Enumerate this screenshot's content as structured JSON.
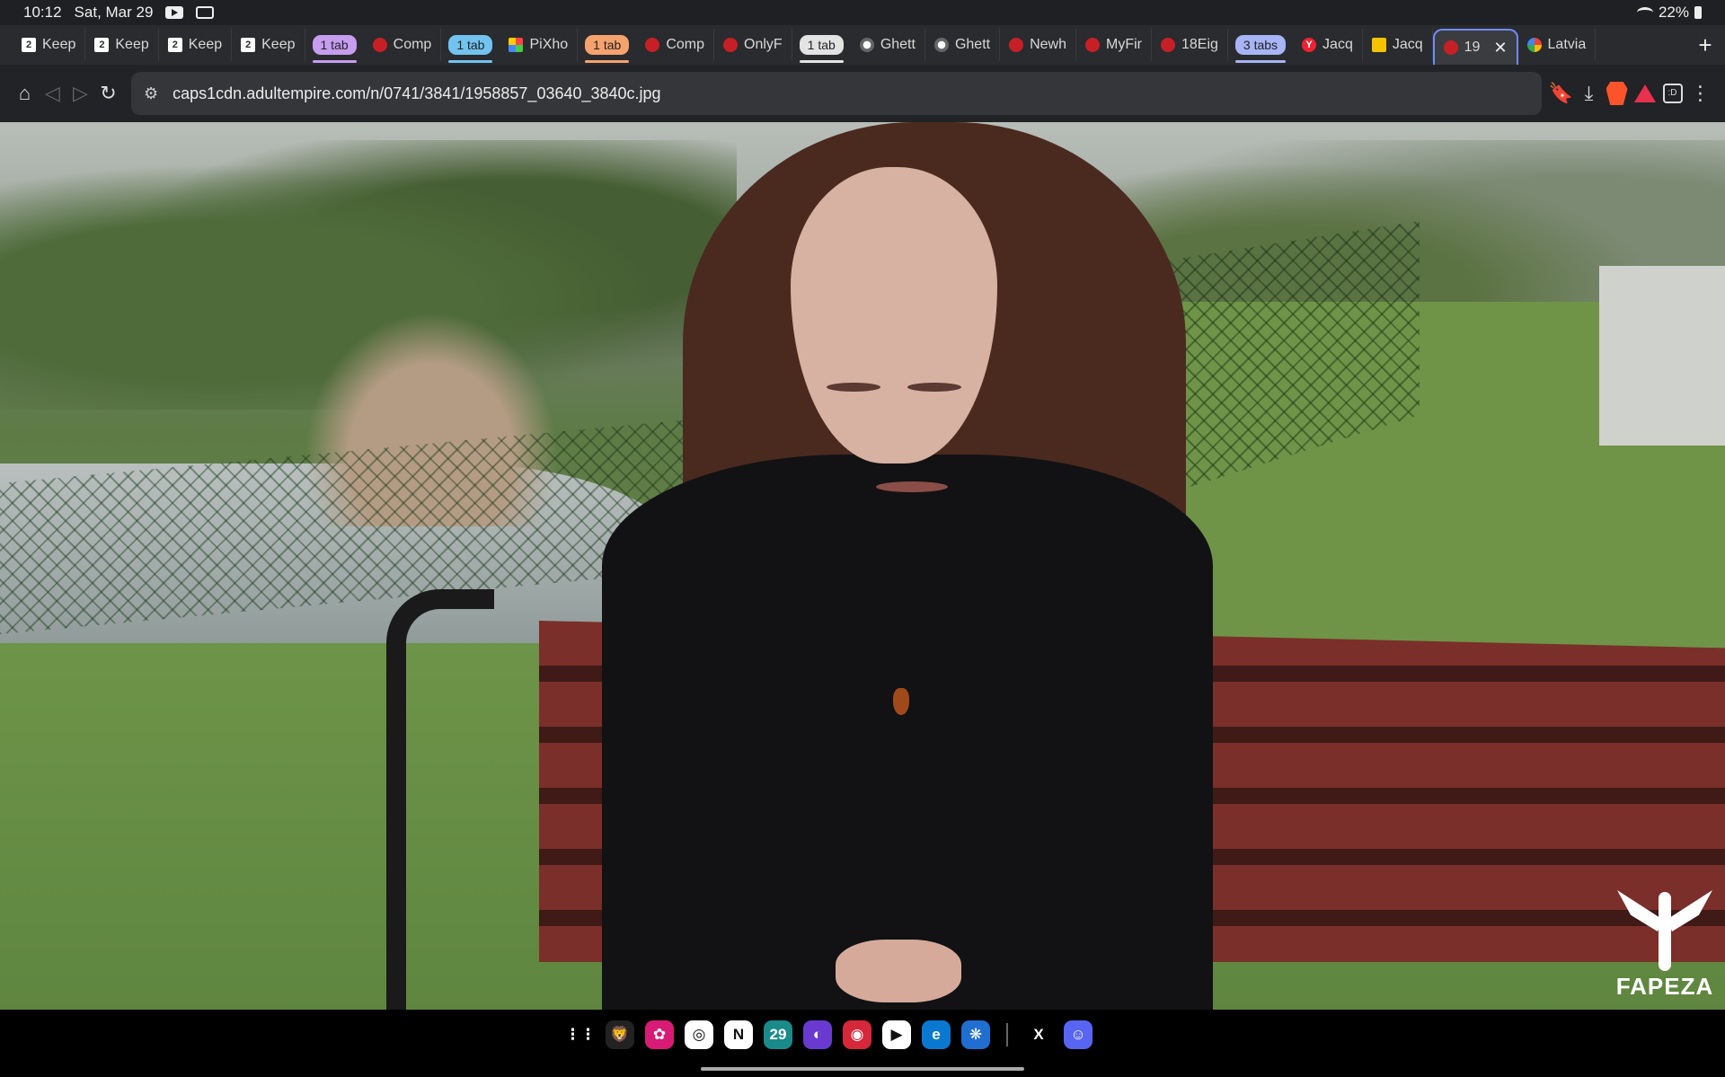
{
  "status_bar": {
    "time": "10:12",
    "date": "Sat, Mar 29",
    "battery": "22%"
  },
  "tabs": [
    {
      "kind": "tab",
      "title": "Keep",
      "favicon": "keep-icon",
      "truncated": true
    },
    {
      "kind": "tab",
      "title": "Keep",
      "favicon": "keep-icon"
    },
    {
      "kind": "tab",
      "title": "Keep",
      "favicon": "keep-icon"
    },
    {
      "kind": "tab",
      "title": "Keep",
      "favicon": "keep-icon"
    },
    {
      "kind": "group",
      "label": "1 tab",
      "color": "#c79df0"
    },
    {
      "kind": "tab",
      "title": "Comp",
      "favicon": "red-record-icon"
    },
    {
      "kind": "group",
      "label": "1 tab",
      "color": "#72c3ef"
    },
    {
      "kind": "tab",
      "title": "PiXho",
      "favicon": "pixhost-icon"
    },
    {
      "kind": "group",
      "label": "1 tab",
      "color": "#f6a26e"
    },
    {
      "kind": "tab",
      "title": "Comp",
      "favicon": "red-record-icon"
    },
    {
      "kind": "tab",
      "title": "OnlyF",
      "favicon": "red-record-icon"
    },
    {
      "kind": "group",
      "label": "1 tab",
      "color": "#e3e3e3"
    },
    {
      "kind": "tab",
      "title": "Ghett",
      "favicon": "ghetto-icon"
    },
    {
      "kind": "tab",
      "title": "Ghett",
      "favicon": "ghetto-icon"
    },
    {
      "kind": "tab",
      "title": "Newh",
      "favicon": "red-record-icon"
    },
    {
      "kind": "tab",
      "title": "MyFir",
      "favicon": "red-record-icon"
    },
    {
      "kind": "tab",
      "title": "18Eig",
      "favicon": "red-record-icon"
    },
    {
      "kind": "group",
      "label": "3 tabs",
      "color": "#a7b4f5"
    },
    {
      "kind": "tab",
      "title": "Jacq",
      "favicon": "y-icon"
    },
    {
      "kind": "tab",
      "title": "Jacq",
      "favicon": "jacquie-icon"
    },
    {
      "kind": "tab",
      "title": "19",
      "favicon": "empire-icon",
      "active": true
    },
    {
      "kind": "tab",
      "title": "Latvia",
      "favicon": "google-icon"
    }
  ],
  "toolbar": {
    "url": "caps1cdn.adultempire.com/n/0741/3841/1958857_03640_3840c.jpg"
  },
  "watermark": {
    "text": "FAPEZA"
  },
  "dock": {
    "apps": [
      {
        "name": "app-drawer-icon",
        "glyph": "⋮⋮",
        "color": "#000000"
      },
      {
        "name": "brave-browser-icon",
        "glyph": "🦁",
        "color": "#222222"
      },
      {
        "name": "blossom-app-icon",
        "glyph": "✿",
        "color": "#d81b74"
      },
      {
        "name": "chatgpt-icon",
        "glyph": "◎",
        "color": "#ffffff"
      },
      {
        "name": "notion-icon",
        "glyph": "N",
        "color": "#ffffff"
      },
      {
        "name": "calendar-icon",
        "glyph": "29",
        "color": "#1a8a8a"
      },
      {
        "name": "firefox-icon",
        "glyph": "◐",
        "color": "#6a3ad0"
      },
      {
        "name": "camera-app-icon",
        "glyph": "◉",
        "color": "#d6283a"
      },
      {
        "name": "play-store-icon",
        "glyph": "▶",
        "color": "#ffffff"
      },
      {
        "name": "edge-icon",
        "glyph": "e",
        "color": "#0a78d0"
      },
      {
        "name": "settings-flower-icon",
        "glyph": "❋",
        "color": "#1f6ed0"
      },
      {
        "name": "x-twitter-icon",
        "glyph": "X",
        "color": "#000000"
      },
      {
        "name": "discord-icon",
        "glyph": "☺",
        "color": "#5865f2"
      }
    ]
  }
}
